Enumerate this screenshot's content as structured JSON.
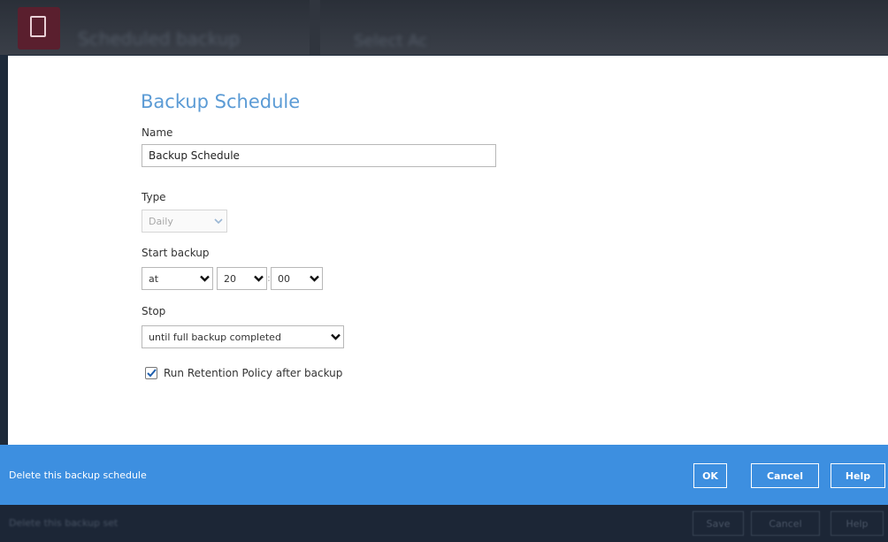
{
  "background": {
    "app_title": "Scheduled backup",
    "page_title": "Select Ac",
    "footer_link": "Delete this backup set",
    "buttons": {
      "save": "Save",
      "cancel": "Cancel",
      "help": "Help"
    }
  },
  "dialog": {
    "title": "Backup Schedule",
    "name": {
      "label": "Name",
      "value": "Backup Schedule"
    },
    "type": {
      "label": "Type",
      "value": "Daily"
    },
    "start_backup": {
      "label": "Start backup",
      "mode": "at",
      "hour": "20",
      "minute": "00",
      "separator": ":"
    },
    "stop": {
      "label": "Stop",
      "value": "until full backup completed"
    },
    "retention": {
      "label": "Run Retention Policy after backup",
      "checked": true
    }
  },
  "footer": {
    "delete_link": "Delete this backup schedule",
    "ok": "OK",
    "cancel": "Cancel",
    "help": "Help"
  },
  "colors": {
    "accent": "#3d8fe0",
    "title_blue": "#5b9bd5",
    "dark_bg": "#1c2636"
  }
}
